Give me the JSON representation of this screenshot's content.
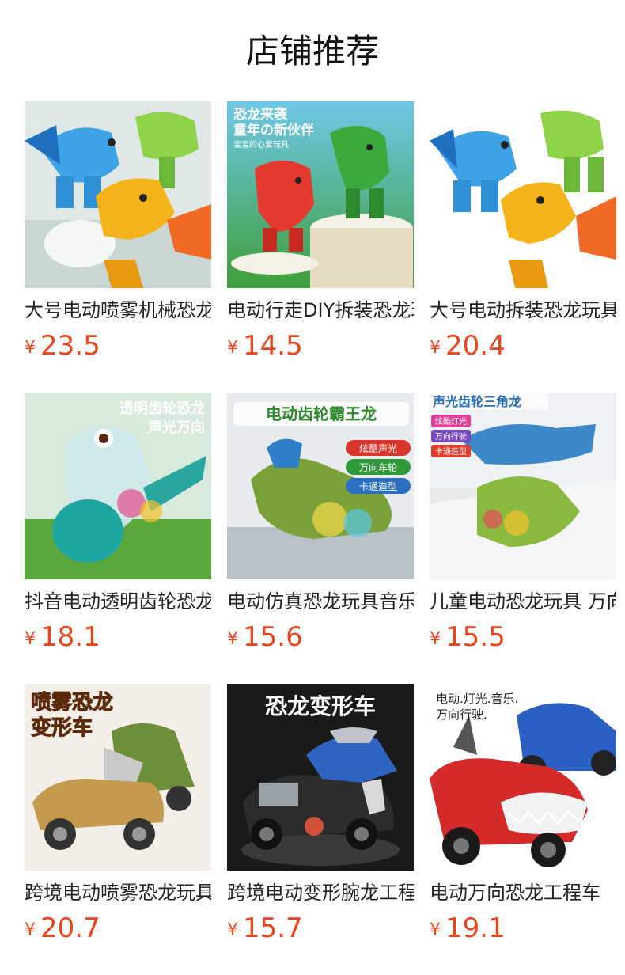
{
  "page": {
    "title": "店铺推荐"
  },
  "colors": {
    "price": "#e8461e",
    "title": "#111111",
    "name": "#222222"
  },
  "products": [
    {
      "name": "大号电动喷雾机械恐龙玩具",
      "currency": "¥",
      "price": "23.5",
      "image_text": []
    },
    {
      "name": "电动行走DIY拆装恐龙玩具",
      "currency": "¥",
      "price": "14.5",
      "image_text": [
        "恐龙来袭",
        "童年の新伙伴",
        "宝宝的心爱玩具"
      ]
    },
    {
      "name": "大号电动拆装恐龙玩具",
      "currency": "¥",
      "price": "20.4",
      "image_text": []
    },
    {
      "name": "抖音电动透明齿轮恐龙",
      "currency": "¥",
      "price": "18.1",
      "image_text": [
        "透明齿轮恐龙",
        "声光万向"
      ]
    },
    {
      "name": "电动仿真恐龙玩具音乐",
      "currency": "¥",
      "price": "15.6",
      "image_text": [
        "电动齿轮霸王龙",
        "炫酷声光",
        "万向车轮",
        "卡通造型"
      ]
    },
    {
      "name": "儿童电动恐龙玩具 万向",
      "currency": "¥",
      "price": "15.5",
      "image_text": [
        "声光齿轮三角龙",
        "炫酷灯光",
        "万向行驶",
        "卡通造型"
      ]
    },
    {
      "name": "跨境电动喷雾恐龙玩具",
      "currency": "¥",
      "price": "20.7",
      "image_text": [
        "喷雾恐龙",
        "变形车"
      ]
    },
    {
      "name": "跨境电动变形腕龙工程车",
      "currency": "¥",
      "price": "15.7",
      "image_text": [
        "恐龙变形车"
      ]
    },
    {
      "name": "电动万向恐龙工程车",
      "currency": "¥",
      "price": "19.1",
      "image_text": [
        "电动.灯光.音乐.",
        "万向行驶."
      ]
    }
  ]
}
